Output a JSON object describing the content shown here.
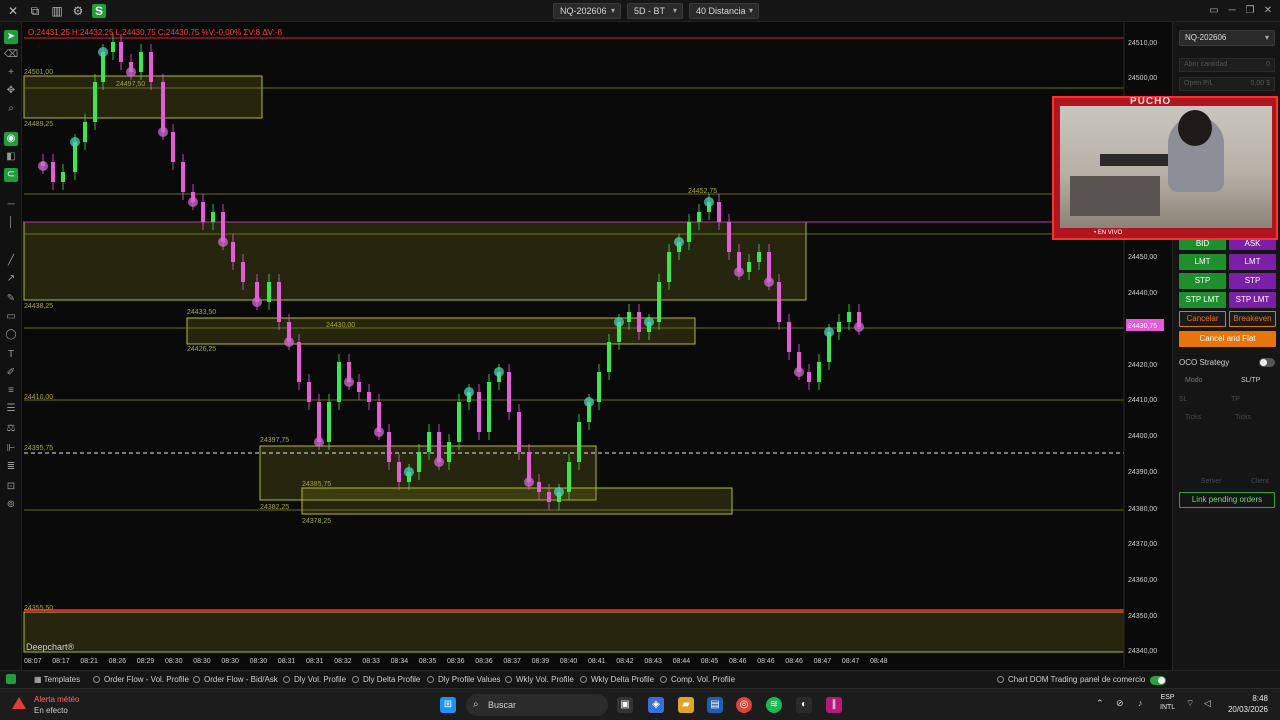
{
  "toolbar": {
    "instrument": "NQ-202606",
    "timeframe": "5D - BT",
    "chart_type": "40 Distancia",
    "icons": [
      "close-icon",
      "layout-icon",
      "bars-icon",
      "settings-icon",
      "s-badge-icon"
    ]
  },
  "chart": {
    "ohlc_text": "O:24431,25  H:24432,25  L:24430,75  C:24430,75  %V:-0,00%  ΣV:8  ΔV:-8",
    "brand": "Deepchart®",
    "price_axis": [
      "24510,00",
      "24500,00",
      "24450,00",
      "24440,00",
      "24430,75",
      "24420,00",
      "24410,00",
      "24400,00",
      "24390,00",
      "24380,00",
      "24370,00",
      "24360,00",
      "24350,00",
      "24340,00"
    ],
    "time_axis": [
      "08:07",
      "08:17",
      "08:21",
      "08:26",
      "08:29",
      "08:30",
      "08:30",
      "08:30",
      "08:30",
      "08:31",
      "08:31",
      "08:32",
      "08:33",
      "08:34",
      "08:35",
      "08:36",
      "08:36",
      "08:37",
      "08:39",
      "08:40",
      "08:41",
      "08:42",
      "08:43",
      "08:44",
      "08:45",
      "08:46",
      "08:46",
      "08:46",
      "08:47",
      "08:47",
      "08:48"
    ],
    "level_labels": [
      "24501,00",
      "24497,50",
      "24489,25",
      "24438,25",
      "24433,50",
      "24426,25",
      "24430,00",
      "24410,00",
      "24395,75",
      "24397,75",
      "24385,75",
      "24382,25",
      "24378,25",
      "24355,50",
      "24452,75"
    ],
    "current_price": "24430,75",
    "colors": {
      "bull": "#39e84a",
      "bear": "#e65bd7",
      "zone": "#8f8f1e",
      "line_red": "#e01e2a",
      "line_magenta": "#c231a8"
    }
  },
  "right_panel": {
    "instrument": "NQ-202606",
    "open_qty_label": "Abrir cantidad",
    "open_qty_value": "0",
    "open_pl_label": "Open P/L",
    "open_pl_value": "0,00 $",
    "bid": "BID",
    "ask": "ASK",
    "lmt_buy": "LMT",
    "lmt_sell": "LMT",
    "stp_buy": "STP",
    "stp_sell": "STP",
    "stplmt_buy": "STP LMT",
    "stplmt_sell": "STP LMT",
    "cancel": "Cancelar",
    "breakeven": "Breakeven",
    "cancel_flat": "Cancel and Flat",
    "oco_label": "OCO Strategy",
    "mode_label": "Modo",
    "mode_value": "SL/TP",
    "sl": "SL",
    "tp": "TP",
    "ticks1": "Ticks",
    "ticks2": "Ticks",
    "server": "Server",
    "client": "Client",
    "link_pending": "Link pending orders"
  },
  "webcam": {
    "title": "PUCHO",
    "live": "• EN VIVO"
  },
  "bottom_tabs": {
    "templates": "Templates",
    "items": [
      "Order Flow - Vol. Profile",
      "Order Flow - Bid/Ask",
      "Dly Vol. Profile",
      "Dly Delta Profile",
      "Dly Profile Values",
      "Wkly Vol. Profile",
      "Wkly Delta Profile",
      "Comp. Vol. Profile"
    ],
    "chart_dom": "Chart DOM Trading",
    "panel": "panel de comercio"
  },
  "taskbar": {
    "alert_title": "Alerta météo",
    "alert_sub": "En efecto",
    "search_placeholder": "Buscar",
    "lang1": "ESP",
    "lang2": "INTL",
    "time": "8:48",
    "date": "20/03/2026"
  }
}
